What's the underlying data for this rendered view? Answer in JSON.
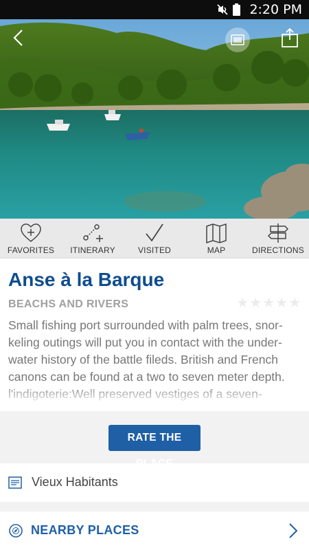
{
  "status_bar": {
    "time": "2:20 PM"
  },
  "actions": [
    {
      "label": "FAVORITES",
      "icon": "heart-plus-icon"
    },
    {
      "label": "ITINERARY",
      "icon": "route-icon"
    },
    {
      "label": "VISITED",
      "icon": "checkmark-icon"
    },
    {
      "label": "MAP",
      "icon": "map-icon"
    },
    {
      "label": "DIRECTIONS",
      "icon": "signpost-icon"
    }
  ],
  "place": {
    "title": "Anse à la Barque",
    "category": "BEACHS AND RIVERS",
    "rating": 0,
    "description": "Small fishing port surrounded with palm trees, snor-keling outings will put you in contact with the under-water history of the battle fileds. British and French canons can be found at a two to seven meter depth. l'indigoterie:Well preserved vestiges of a seven-"
  },
  "rate_button": "RATE THE PLACE",
  "location": "Vieux Habitants",
  "nearby": "NEARBY PLACES",
  "colors": {
    "accent": "#1f5fa6",
    "title": "#0e4d8e",
    "status_bar": "#0d0d0d"
  }
}
